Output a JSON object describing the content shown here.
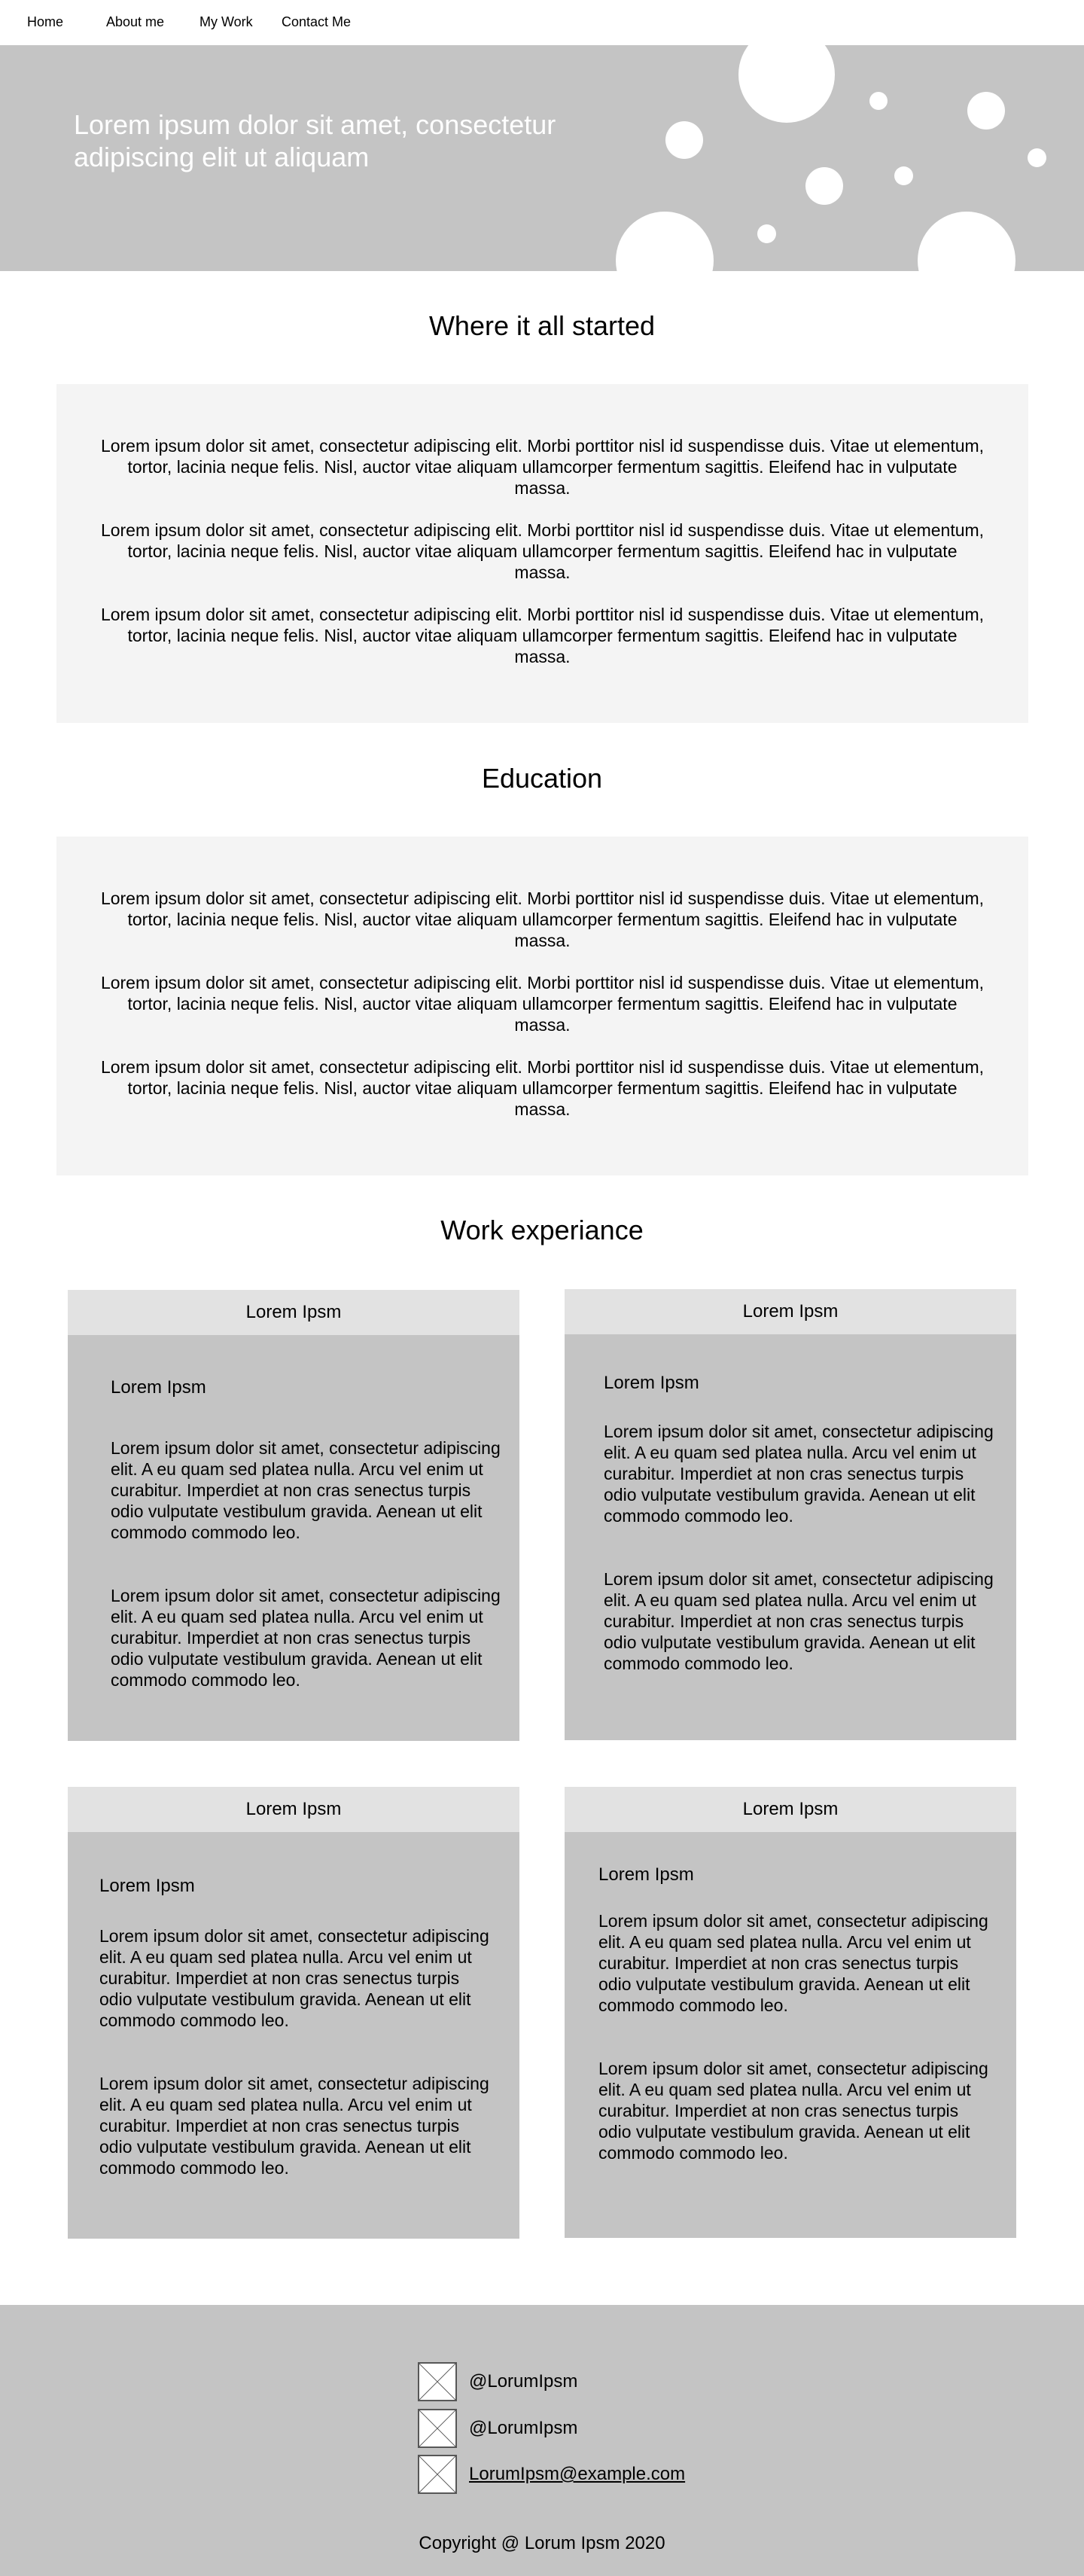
{
  "nav": {
    "items": [
      "Home",
      "About me",
      "My Work",
      "Contact Me"
    ]
  },
  "hero": {
    "title": "Lorem ipsum dolor sit amet, consectetur adipiscing elit ut aliquam"
  },
  "started": {
    "title": "Where it all started",
    "paragraphs": [
      "Lorem ipsum dolor sit amet, consectetur adipiscing elit. Morbi porttitor nisl id suspendisse duis. Vitae ut elementum, tortor, lacinia neque felis. Nisl, auctor vitae aliquam ullamcorper fermentum sagittis. Eleifend hac in vulputate massa.",
      "Lorem ipsum dolor sit amet, consectetur adipiscing elit. Morbi porttitor nisl id suspendisse duis. Vitae ut elementum, tortor, lacinia neque felis. Nisl, auctor vitae aliquam ullamcorper fermentum sagittis. Eleifend hac in vulputate massa.",
      "Lorem ipsum dolor sit amet, consectetur adipiscing elit. Morbi porttitor nisl id suspendisse duis. Vitae ut elementum, tortor, lacinia neque felis. Nisl, auctor vitae aliquam ullamcorper fermentum sagittis. Eleifend hac in vulputate massa."
    ]
  },
  "education": {
    "title": "Education",
    "paragraphs": [
      "Lorem ipsum dolor sit amet, consectetur adipiscing elit. Morbi porttitor nisl id suspendisse duis. Vitae ut elementum, tortor, lacinia neque felis. Nisl, auctor vitae aliquam ullamcorper fermentum sagittis. Eleifend hac in vulputate massa.",
      "Lorem ipsum dolor sit amet, consectetur adipiscing elit. Morbi porttitor nisl id suspendisse duis. Vitae ut elementum, tortor, lacinia neque felis. Nisl, auctor vitae aliquam ullamcorper fermentum sagittis. Eleifend hac in vulputate massa.",
      "Lorem ipsum dolor sit amet, consectetur adipiscing elit. Morbi porttitor nisl id suspendisse duis. Vitae ut elementum, tortor, lacinia neque felis. Nisl, auctor vitae aliquam ullamcorper fermentum sagittis. Eleifend hac in vulputate massa."
    ]
  },
  "work": {
    "title": "Work experiance",
    "cards": [
      {
        "header": "Lorem Ipsm",
        "subtitle": "Lorem Ipsm",
        "paragraphs": [
          "Lorem ipsum dolor sit amet, consectetur adipiscing elit. A eu quam sed platea nulla. Arcu vel enim ut curabitur. Imperdiet at non cras senectus turpis odio vulputate vestibulum gravida. Aenean ut elit commodo commodo leo.",
          "Lorem ipsum dolor sit amet, consectetur adipiscing elit. A eu quam sed platea nulla. Arcu vel enim ut curabitur. Imperdiet at non cras senectus turpis odio vulputate vestibulum gravida. Aenean ut elit commodo commodo leo."
        ]
      },
      {
        "header": "Lorem Ipsm",
        "subtitle": "Lorem Ipsm",
        "paragraphs": [
          "Lorem ipsum dolor sit amet, consectetur adipiscing elit. A eu quam sed platea nulla. Arcu vel enim ut curabitur. Imperdiet at non cras senectus turpis odio vulputate vestibulum gravida. Aenean ut elit commodo commodo leo.",
          "Lorem ipsum dolor sit amet, consectetur adipiscing elit. A eu quam sed platea nulla. Arcu vel enim ut curabitur. Imperdiet at non cras senectus turpis odio vulputate vestibulum gravida. Aenean ut elit commodo commodo leo."
        ]
      },
      {
        "header": "Lorem Ipsm",
        "subtitle": "Lorem Ipsm",
        "paragraphs": [
          "Lorem ipsum dolor sit amet, consectetur adipiscing elit. A eu quam sed platea nulla. Arcu vel enim ut curabitur. Imperdiet at non cras senectus turpis odio vulputate vestibulum gravida. Aenean ut elit commodo commodo leo.",
          "Lorem ipsum dolor sit amet, consectetur adipiscing elit. A eu quam sed platea nulla. Arcu vel enim ut curabitur. Imperdiet at non cras senectus turpis odio vulputate vestibulum gravida. Aenean ut elit commodo commodo leo."
        ]
      },
      {
        "header": "Lorem Ipsm",
        "subtitle": "Lorem Ipsm",
        "paragraphs": [
          "Lorem ipsum dolor sit amet, consectetur adipiscing elit. A eu quam sed platea nulla. Arcu vel enim ut curabitur. Imperdiet at non cras senectus turpis odio vulputate vestibulum gravida. Aenean ut elit commodo commodo leo.",
          "Lorem ipsum dolor sit amet, consectetur adipiscing elit. A eu quam sed platea nulla. Arcu vel enim ut curabitur. Imperdiet at non cras senectus turpis odio vulputate vestibulum gravida. Aenean ut elit commodo commodo leo."
        ]
      }
    ]
  },
  "footer": {
    "social": [
      {
        "icon": "image-placeholder-icon",
        "text": "@LorumIpsm"
      },
      {
        "icon": "image-placeholder-icon",
        "text": "@LorumIpsm"
      },
      {
        "icon": "image-placeholder-icon",
        "text": "LorumIpsm@example.com"
      }
    ],
    "copyright": "Copyright @ Lorum Ipsm 2020"
  }
}
